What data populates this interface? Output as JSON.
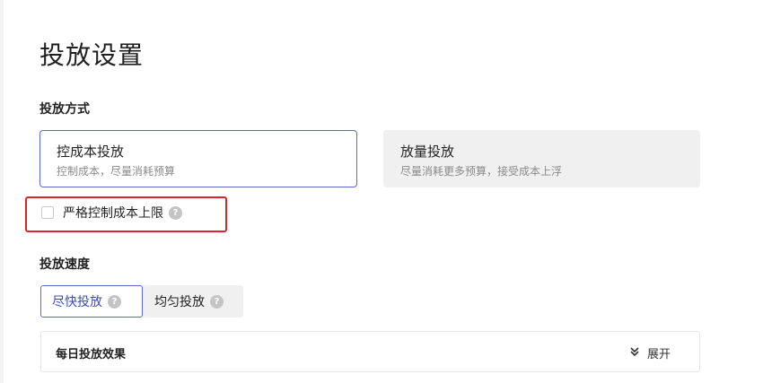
{
  "page": {
    "title": "投放设置"
  },
  "delivery_method": {
    "label": "投放方式",
    "options": [
      {
        "title": "控成本投放",
        "desc": "控制成本，尽量消耗预算",
        "selected": true
      },
      {
        "title": "放量投放",
        "desc": "尽量消耗更多预算，接受成本上浮",
        "selected": false
      }
    ],
    "strict_cost_cap": {
      "label": "严格控制成本上限",
      "checked": false,
      "help_icon": "question-mark-icon"
    }
  },
  "delivery_speed": {
    "label": "投放速度",
    "options": [
      {
        "label": "尽快投放",
        "selected": true,
        "help_icon": "question-mark-icon"
      },
      {
        "label": "均匀投放",
        "selected": false,
        "help_icon": "question-mark-icon"
      }
    ]
  },
  "daily_effect": {
    "title": "每日投放效果",
    "expand_label": "展开",
    "expand_icon": "double-chevron-down-icon"
  },
  "colors": {
    "accent": "#5a67d8",
    "highlight": "#d7262b",
    "inactive_bg": "#f0f0f0"
  }
}
